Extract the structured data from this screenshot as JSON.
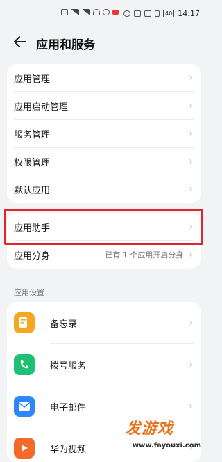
{
  "status_bar": {
    "time": "14:17",
    "battery": "40"
  },
  "header": {
    "title": "应用和服务"
  },
  "group1": [
    {
      "label": "应用管理"
    },
    {
      "label": "应用启动管理"
    },
    {
      "label": "服务管理"
    },
    {
      "label": "权限管理"
    },
    {
      "label": "默认应用"
    }
  ],
  "group2": [
    {
      "label": "应用助手",
      "value": ""
    },
    {
      "label": "应用分身",
      "value": "已有 1 个应用开启分身"
    }
  ],
  "app_settings": {
    "section_title": "应用设置",
    "apps": [
      {
        "label": "备忘录",
        "icon": "memo-icon",
        "color": "#f6a623"
      },
      {
        "label": "拨号服务",
        "icon": "phone-icon",
        "color": "#1fbf74"
      },
      {
        "label": "电子邮件",
        "icon": "mail-icon",
        "color": "#2f86f6"
      },
      {
        "label": "华为视频",
        "icon": "video-icon",
        "color": "#f46a2b"
      }
    ]
  },
  "highlight_color": "#e0262d",
  "watermark": {
    "title": "发游戏",
    "url": "www.fayouxi.com"
  }
}
